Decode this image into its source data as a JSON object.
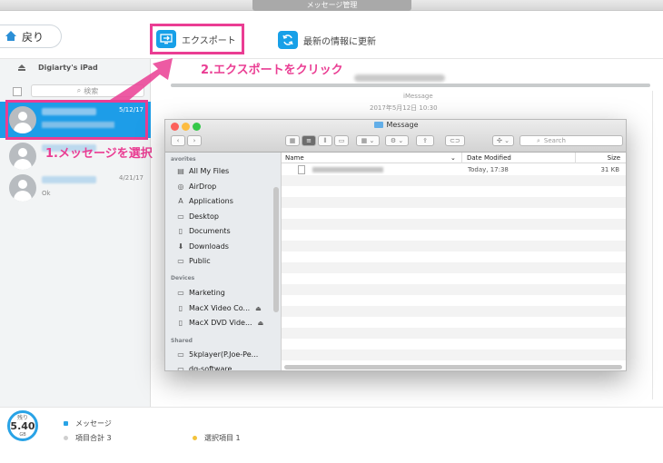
{
  "window": {
    "title": "メッセージ管理"
  },
  "toolbar": {
    "back_label": "戻り",
    "export_label": "エクスポート",
    "update_label": "最新の情報に更新"
  },
  "sidebar": {
    "device_name": "Digiarty's iPad",
    "search_placeholder": "検索",
    "messages": [
      {
        "date": "5/12/17",
        "subtitle": "",
        "selected": true
      },
      {
        "date": "",
        "subtitle": "",
        "selected": false
      },
      {
        "date": "4/21/17",
        "subtitle": "Ok",
        "selected": false
      }
    ]
  },
  "conversation": {
    "service": "iMessage",
    "timestamp": "2017年5月12日 10:30"
  },
  "annotations": {
    "step1": "1.メッセージを選択",
    "step2": "2.エクスポートをクリック"
  },
  "footer": {
    "storage_label": "残り",
    "storage_value": "5.40",
    "storage_unit": "GB",
    "legend_messages": "メッセージ",
    "total_items": "項目合計 3",
    "selected_items": "選択項目 1"
  },
  "finder": {
    "title": "Message",
    "search_placeholder": "Search",
    "favorites_header": "avorites",
    "favorites": [
      "All My Files",
      "AirDrop",
      "Applications",
      "Desktop",
      "Documents",
      "Downloads",
      "Public"
    ],
    "devices_header": "Devices",
    "devices": [
      "Marketing",
      "MacX Video Co...",
      "MacX DVD Vide..."
    ],
    "shared_header": "Shared",
    "shared": [
      "5kplayer(P.Joe-Pe...",
      "dg-software"
    ],
    "columns": {
      "name": "Name",
      "date": "Date Modified",
      "size": "Size"
    },
    "files": [
      {
        "date": "Today, 17:38",
        "size": "31 KB"
      }
    ]
  },
  "colors": {
    "accent": "#1d9de8",
    "annotation": "#ea3d93"
  }
}
